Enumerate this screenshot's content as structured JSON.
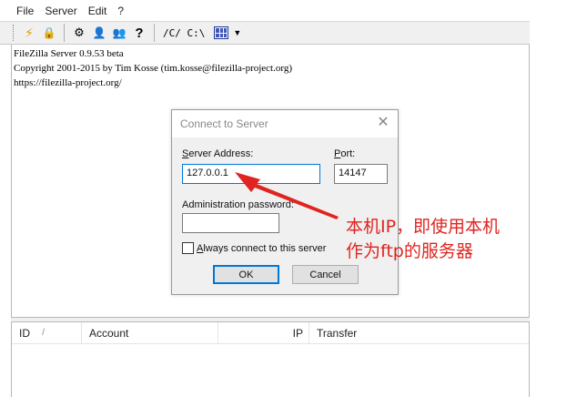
{
  "menu": [
    "File",
    "Server",
    "Edit",
    "?"
  ],
  "toolbar": {
    "buttons": [
      {
        "name": "lightning-icon",
        "glyph": "⚡"
      },
      {
        "name": "lock-icon",
        "glyph": "🔒"
      },
      {
        "name": "settings-icon",
        "glyph": "⚙"
      },
      {
        "name": "user-icon",
        "glyph": "👤"
      },
      {
        "name": "group-icon",
        "glyph": "👥"
      },
      {
        "name": "help-icon",
        "glyph": "?"
      }
    ],
    "path_text": "/C/ C:\\"
  },
  "log": {
    "lines": [
      "FileZilla Server 0.9.53 beta",
      "Copyright 2001-2015 by Tim Kosse (tim.kosse@filezilla-project.org)",
      "https://filezilla-project.org/"
    ]
  },
  "users_table": {
    "headers": [
      "ID",
      "/",
      "Account",
      "IP",
      "Transfer"
    ]
  },
  "dialog": {
    "title": "Connect to Server",
    "server_address_label_u": "S",
    "server_address_label_rest": "erver Address:",
    "server_address_value": "127.0.0.1",
    "port_label_u": "P",
    "port_label_rest": "ort:",
    "port_value": "14147",
    "password_label": "Administration password:",
    "password_value": "",
    "always_connect_u": "A",
    "always_connect_rest": "lways connect to this server",
    "ok_label": "OK",
    "cancel_label": "Cancel"
  },
  "annotation": {
    "line1": "本机IP，即使用本机",
    "line2": "作为ftp的服务器",
    "color": "#e0241f"
  }
}
